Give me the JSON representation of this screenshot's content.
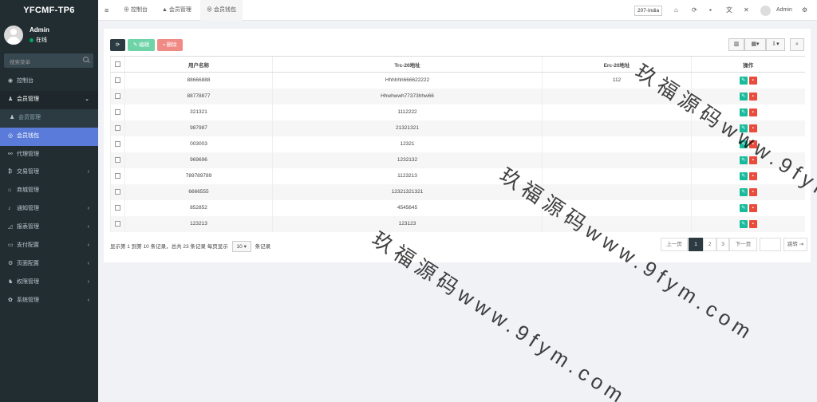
{
  "brand": "YFCMF-TP6",
  "user": {
    "name": "Admin",
    "status": "在线"
  },
  "sidebar_search": {
    "placeholder": "搜索菜单"
  },
  "menu": [
    {
      "icon": "dashboard-icon",
      "label": "控制台",
      "chev": ""
    },
    {
      "icon": "user-icon",
      "label": "会员管理",
      "chev": "⌄"
    },
    {
      "icon": "user-icon",
      "label": "会员管理",
      "chev": ""
    },
    {
      "icon": "wallet-icon",
      "label": "会员钱包",
      "chev": ""
    },
    {
      "icon": "sitemap-icon",
      "label": "代理管理",
      "chev": ""
    },
    {
      "icon": "bitcoin-icon",
      "label": "交易管理",
      "chev": "‹"
    },
    {
      "icon": "home-icon",
      "label": "商城管理",
      "chev": ""
    },
    {
      "icon": "bell-icon",
      "label": "通知管理",
      "chev": "‹"
    },
    {
      "icon": "chart-icon",
      "label": "报表管理",
      "chev": "‹"
    },
    {
      "icon": "credit-card-icon",
      "label": "支付配置",
      "chev": "‹"
    },
    {
      "icon": "gear-icon",
      "label": "页面配置",
      "chev": "‹"
    },
    {
      "icon": "users-icon",
      "label": "权限管理",
      "chev": "‹"
    },
    {
      "icon": "gears-icon",
      "label": "系统管理",
      "chev": "‹"
    }
  ],
  "topbar": {
    "tabs": [
      "控制台",
      "会员管理",
      "会员钱包"
    ],
    "region": "207-India",
    "admin": "Admin"
  },
  "toolbar": {
    "refresh": "⟳",
    "edit": "编辑",
    "delete": "删除"
  },
  "table": {
    "headers": [
      "用户名称",
      "Trc-20地址",
      "Erc-20地址",
      "操作"
    ],
    "rows": [
      [
        "88666888",
        "Hhhhhh666622222",
        "112"
      ],
      [
        "88778877",
        "Hhwhwwh77373hhw66",
        ""
      ],
      [
        "321321",
        "1112222",
        ""
      ],
      [
        "987987",
        "21321321",
        ""
      ],
      [
        "003003",
        "12321",
        ""
      ],
      [
        "969696",
        "1232132",
        ""
      ],
      [
        "789789789",
        "1123213",
        ""
      ],
      [
        "6666555",
        "12321321321",
        ""
      ],
      [
        "852852",
        "4545645",
        ""
      ],
      [
        "123213",
        "123123",
        ""
      ]
    ]
  },
  "footer": {
    "summary": "显示第 1 到第 10 条记录，总共 23 条记录 每页显示",
    "page_size": "10",
    "suffix": "条记录"
  },
  "pagination": {
    "prev": "上一页",
    "pages": [
      "1",
      "2",
      "3"
    ],
    "next": "下一页",
    "jump": "跳转"
  },
  "watermark": "玖福源码www.9fym.com"
}
